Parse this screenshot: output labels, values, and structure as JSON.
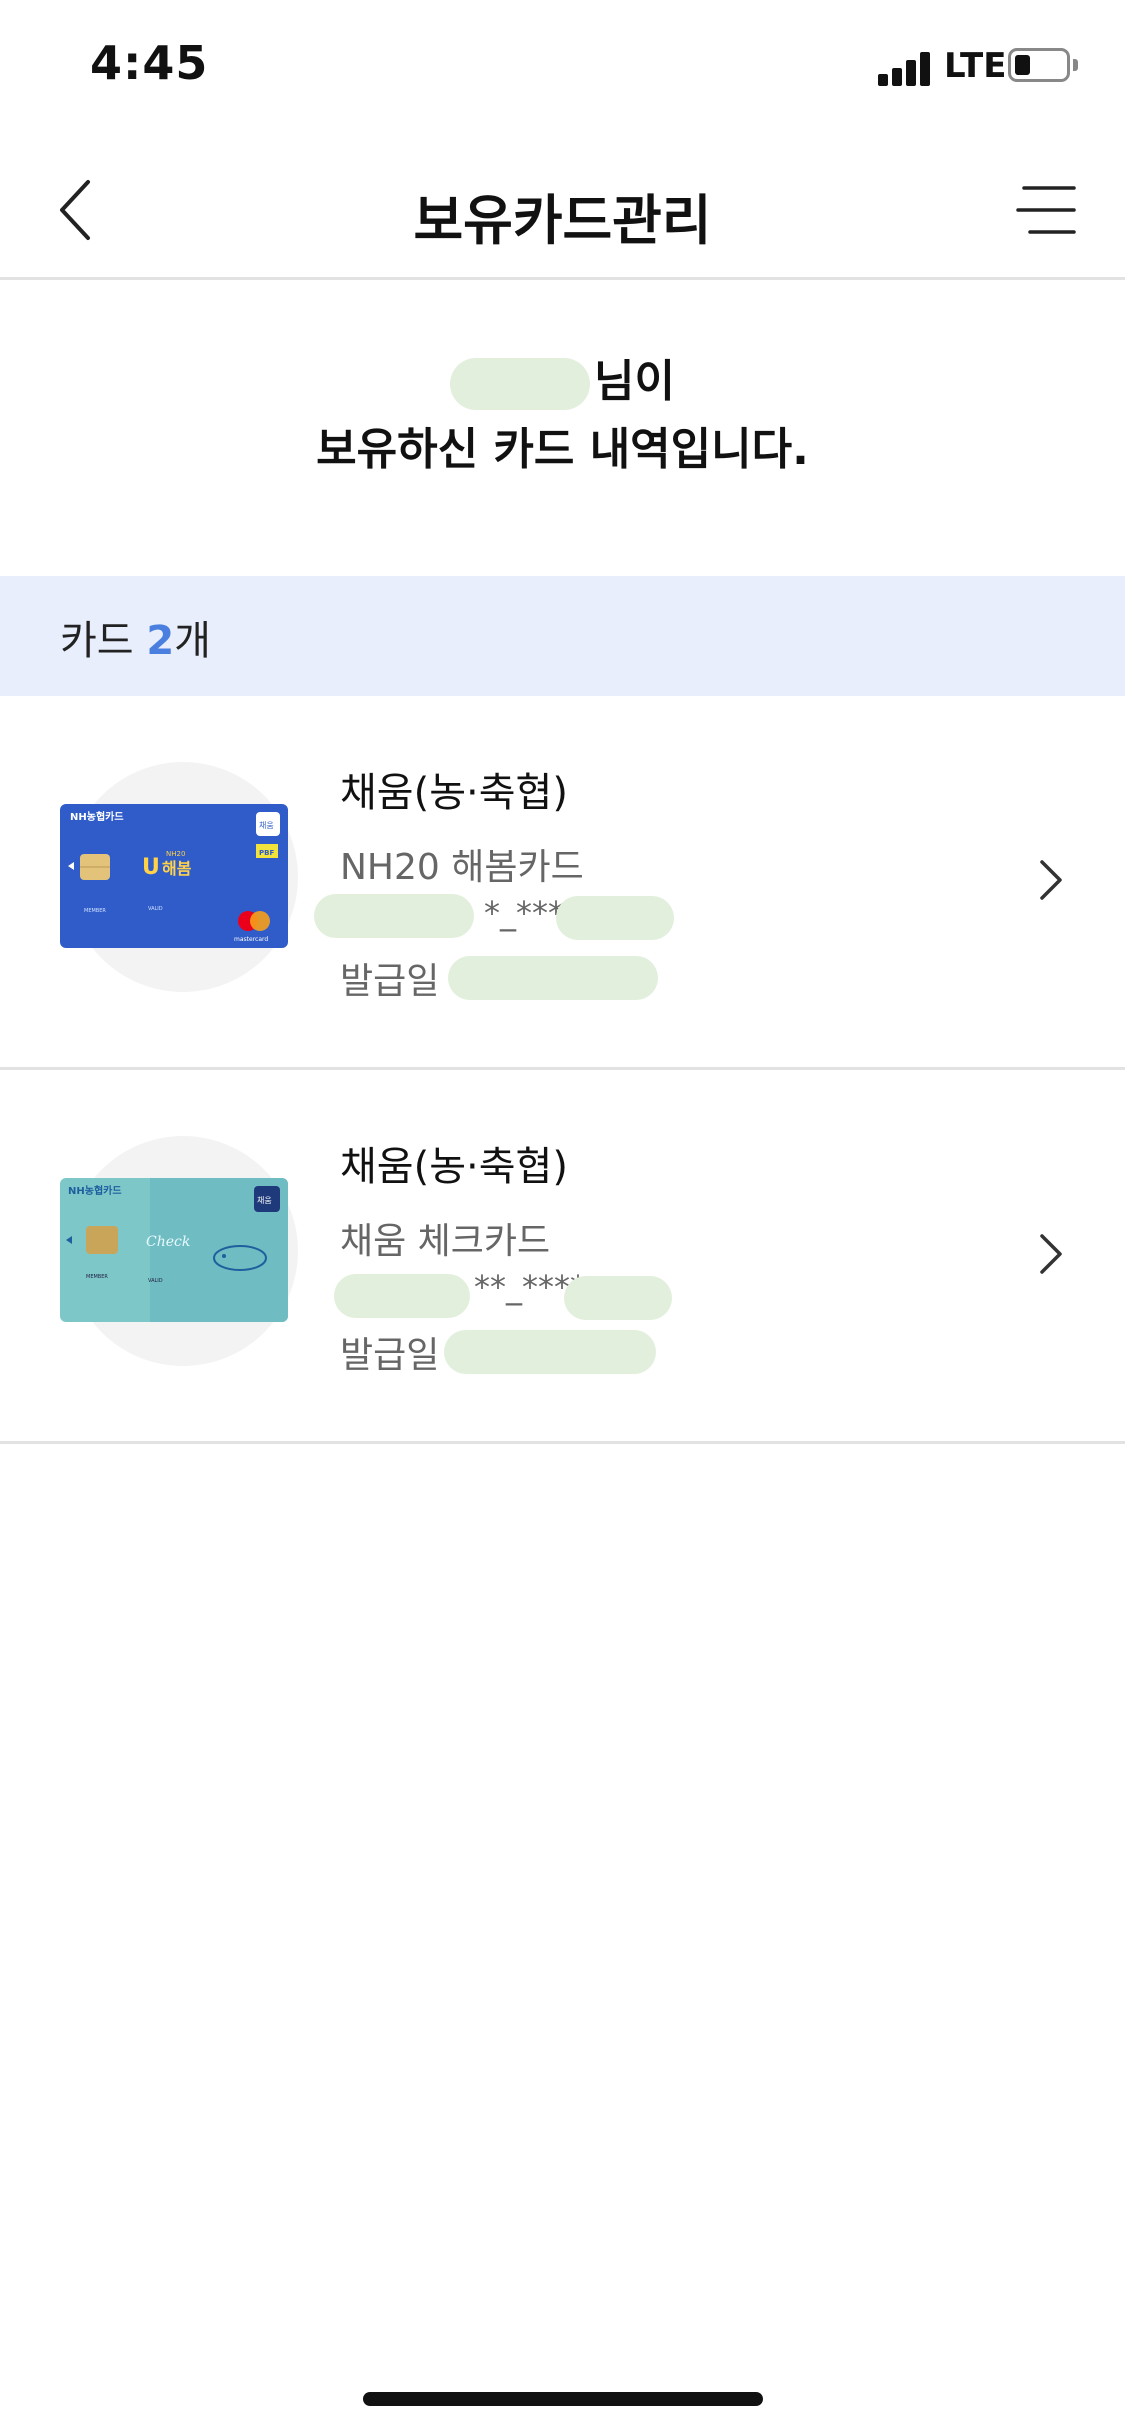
{
  "status_bar": {
    "time": "4:45",
    "network": "LTE",
    "battery_level": 0.3
  },
  "header": {
    "title": "보유카드관리",
    "back_icon": "chevron-left-icon",
    "menu_icon": "hamburger-menu-icon"
  },
  "greeting": {
    "line1_suffix": "님이",
    "line2": "보유하신 카드 내역입니다."
  },
  "card_count": {
    "label": "카드",
    "count": "2",
    "unit": "개"
  },
  "cards": [
    {
      "issuer": "채움(농·축협)",
      "product": "NH20 해봄카드",
      "number_masked": "*_****_",
      "issue_label": "발급일 :",
      "image": {
        "brand": "NH농협카드",
        "title": "해봄",
        "subtitle": "NH20",
        "badge": "채움",
        "network": "mastercard",
        "color": "#2f5cc9"
      }
    },
    {
      "issuer": "채움(농·축협)",
      "product": "채움 체크카드",
      "number_masked": "**_****_",
      "issue_label": "발급일 :",
      "image": {
        "brand": "NH농협카드",
        "title": "Check",
        "badge": "채움",
        "color": "#7ec7c9"
      }
    }
  ],
  "colors": {
    "accent": "#4a7fe0",
    "band": "#e8eefb",
    "divider": "#e2e2e2"
  }
}
